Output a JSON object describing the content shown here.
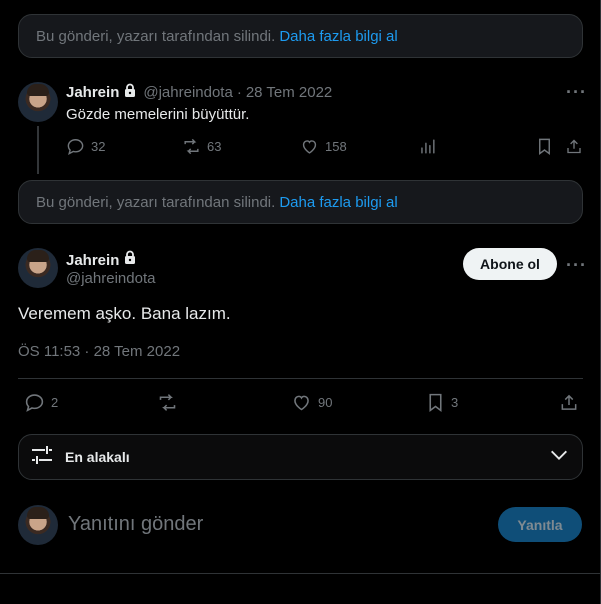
{
  "notice": {
    "deleted_text": "Bu gönderi, yazarı tarafından silindi.",
    "learn_more": "Daha fazla bilgi al"
  },
  "reply_tweet": {
    "display_name": "Jahrein",
    "handle": "@jahreindota",
    "separator": "·",
    "date": "28 Tem 2022",
    "text": "Gözde memelerini büyüttür.",
    "replies": "32",
    "retweets": "63",
    "likes": "158"
  },
  "main_tweet": {
    "display_name": "Jahrein",
    "handle": "@jahreindota",
    "subscribe_label": "Abone ol",
    "text": "Veremem aşko. Bana lazım.",
    "timestamp": "ÖS 11:53 · 28 Tem 2022",
    "replies": "2",
    "likes": "90",
    "bookmarks": "3"
  },
  "sort": {
    "label": "En alakalı"
  },
  "composer": {
    "placeholder": "Yanıtını gönder",
    "button_label": "Yanıtla"
  },
  "colors": {
    "accent": "#1d9bf0",
    "background": "#000000",
    "muted": "#71767b",
    "border": "#2f3336"
  }
}
